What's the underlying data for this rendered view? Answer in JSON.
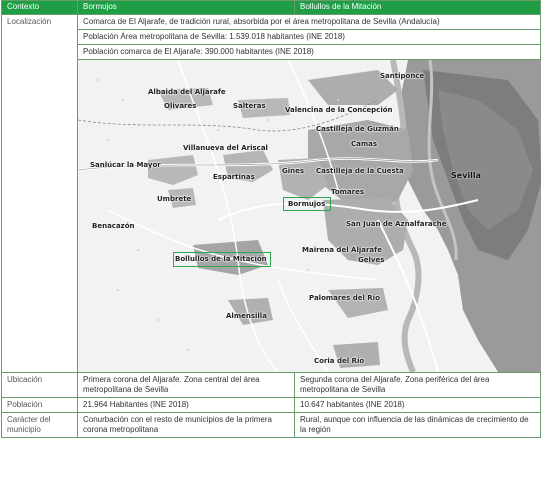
{
  "headers": [
    "Contexto",
    "Bormujos",
    "Bollullos de la Mitación"
  ],
  "localizacion": {
    "label": "Localización",
    "line1": "Comarca de El Aljarafe, de tradición rural, absorbida por el área metropolitana de Sevilla (Andalucía)",
    "line2": "Población Área metropolitana de Sevilla: 1.539.018 habitantes (INE 2018)",
    "line3": "Población comarca de El Aljarafe: 390.000 habitantes (INE 2018)"
  },
  "map": {
    "towns": [
      "Santiponce",
      "Albaida del Aljarafe",
      "Olivares",
      "Salteras",
      "Valencina de la Concepción",
      "Castilleja de Guzmán",
      "Camas",
      "Villanueva del Ariscal",
      "Sanlúcar la Mayor",
      "Espartinas",
      "Gines",
      "Castilleja de la Cuesta",
      "Sevilla",
      "Umbrete",
      "Bormujos",
      "Tomares",
      "Benacazón",
      "San Juan de Aznalfarache",
      "Bollullos de la Mitación",
      "Mairena del Aljarafe",
      "Gelves",
      "Almensilla",
      "Palomares del Río",
      "Coria del Río"
    ],
    "highlight_color": "#2ea84a"
  },
  "rows": [
    {
      "label": "Ubicación",
      "bormujos": "Primera corona del Aljarafe. Zona central del área metropolitana de Sevilla",
      "bollullos": "Segunda corona del Aljarafe. Zona periférica del área metropolitana de Sevilla"
    },
    {
      "label": "Población",
      "bormujos": "21.964 Habitantes (INE 2018)",
      "bollullos": "10.647 habitantes (INE 2018)"
    },
    {
      "label": "Carácter del municipio",
      "bormujos": "Conurbación con el resto de municipios de la primera corona metropolitana",
      "bollullos": "Rural, aunque con influencia de las dinámicas de crecimiento de la región"
    }
  ],
  "colors": {
    "header_bg": "#1f9e46",
    "header_text": "#ffffff",
    "border": "#6a9b6a"
  }
}
